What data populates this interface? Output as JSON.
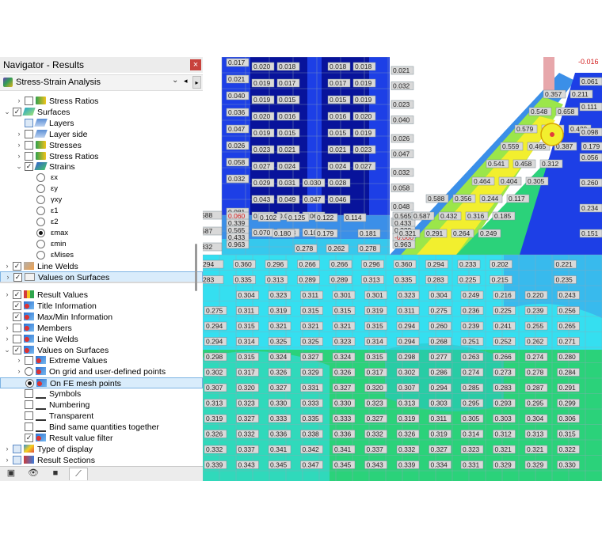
{
  "navigator": {
    "title": "Navigator - Results",
    "close_glyph": "×",
    "analysis": "Stress-Strain Analysis",
    "tree_top": [
      {
        "label": "Stress Ratios",
        "level": 1,
        "expander": "›",
        "check": "unchecked",
        "icon": "stress"
      },
      {
        "label": "Surfaces",
        "level": 0,
        "expander": "⌄",
        "check": "checked",
        "icon": "surface"
      },
      {
        "label": "Layers",
        "level": 1,
        "expander": "",
        "check": "partial",
        "icon": "layer"
      },
      {
        "label": "Layer side",
        "level": 1,
        "expander": "›",
        "check": "unchecked",
        "icon": "layer"
      },
      {
        "label": "Stresses",
        "level": 1,
        "expander": "›",
        "check": "unchecked",
        "icon": "stress"
      },
      {
        "label": "Stress Ratios",
        "level": 1,
        "expander": "›",
        "check": "unchecked",
        "icon": "stress"
      },
      {
        "label": "Strains",
        "level": 1,
        "expander": "⌄",
        "check": "checked",
        "icon": "strain"
      },
      {
        "label": "εx",
        "level": 2,
        "radio": false
      },
      {
        "label": "εy",
        "level": 2,
        "radio": false
      },
      {
        "label": "γxy",
        "level": 2,
        "radio": false
      },
      {
        "label": "ε1",
        "level": 2,
        "radio": false
      },
      {
        "label": "ε2",
        "level": 2,
        "radio": false
      },
      {
        "label": "εmax",
        "level": 2,
        "radio": true
      },
      {
        "label": "εmin",
        "level": 2,
        "radio": false
      },
      {
        "label": "εMises",
        "level": 2,
        "radio": false
      },
      {
        "label": "Line Welds",
        "level": 0,
        "expander": "›",
        "check": "checked",
        "icon": "weld"
      },
      {
        "label": "Values on Surfaces",
        "level": 0,
        "expander": "›",
        "check": "checked",
        "icon": "vals",
        "selected": true
      }
    ],
    "tree_bottom": [
      {
        "label": "Result Values",
        "level": 0,
        "expander": "›",
        "check": "checked",
        "icon": "res"
      },
      {
        "label": "Title Information",
        "level": 0,
        "expander": "",
        "check": "checked",
        "icon": "red"
      },
      {
        "label": "Max/Min Information",
        "level": 0,
        "expander": "",
        "check": "checked",
        "icon": "red"
      },
      {
        "label": "Members",
        "level": 0,
        "expander": "›",
        "check": "unchecked",
        "icon": "red"
      },
      {
        "label": "Line Welds",
        "level": 0,
        "expander": "›",
        "check": "unchecked",
        "icon": "red"
      },
      {
        "label": "Values on Surfaces",
        "level": 0,
        "expander": "⌄",
        "check": "checked",
        "icon": "red"
      },
      {
        "label": "Extreme Values",
        "level": 1,
        "expander": "›",
        "check": "unchecked",
        "icon": "red"
      },
      {
        "label": "On grid and user-defined points",
        "level": 1,
        "expander": "›",
        "radio": false,
        "icon": "red"
      },
      {
        "label": "On FE mesh points",
        "level": 1,
        "expander": "",
        "radio": true,
        "icon": "red",
        "selected": true
      },
      {
        "label": "Symbols",
        "level": 1,
        "expander": "",
        "check": "unchecked",
        "icon": "sym"
      },
      {
        "label": "Numbering",
        "level": 1,
        "expander": "",
        "check": "unchecked",
        "icon": "sym"
      },
      {
        "label": "Transparent",
        "level": 1,
        "expander": "",
        "check": "unchecked",
        "icon": "sym"
      },
      {
        "label": "Bind same quantities together",
        "level": 1,
        "expander": "",
        "check": "unchecked",
        "icon": "sym"
      },
      {
        "label": "Result value filter",
        "level": 1,
        "expander": "",
        "check": "checked",
        "icon": "red"
      },
      {
        "label": "Type of display",
        "level": 0,
        "expander": "›",
        "check": "partial",
        "icon": "disp"
      },
      {
        "label": "Result Sections",
        "level": 0,
        "expander": "›",
        "check": "partial",
        "icon": "sect"
      }
    ],
    "tabs": [
      {
        "name": "data-tab",
        "glyph": "▣"
      },
      {
        "name": "display-tab",
        "glyph": "👁"
      },
      {
        "name": "views-tab",
        "glyph": "■"
      },
      {
        "name": "results-tab",
        "glyph": "⟋",
        "active": true
      }
    ]
  },
  "viewport": {
    "colors": {
      "navy": "#08139b",
      "blue": "#1d3fe6",
      "mid_blue": "#3b8fe8",
      "cyan": "#35dff0",
      "teal": "#26c6c8",
      "green": "#2bd27a",
      "lime": "#9be64a",
      "yellow": "#f2ef2e",
      "pink": "#e7a7ab",
      "grid": "#8fa7b8",
      "label_bg": "#d9d9d9"
    },
    "left_block_labels": [
      [
        "0.017",
        "0.020",
        "0.018",
        "",
        "0.018",
        "0.018"
      ],
      [
        "0.021",
        "0.019",
        "0.017",
        "",
        "0.017",
        "0.019"
      ],
      [
        "0.040",
        "0.019",
        "0.015",
        "",
        "0.015",
        "0.019"
      ],
      [
        "0.036",
        "0.020",
        "0.016",
        "",
        "0.016",
        "0.020"
      ],
      [
        "0.047",
        "0.019",
        "0.015",
        "",
        "0.015",
        "0.019"
      ],
      [
        "0.026",
        "0.023",
        "0.021",
        "",
        "0.021",
        "0.023"
      ],
      [
        "0.058",
        "0.027",
        "0.024",
        "",
        "0.024",
        "0.027"
      ],
      [
        "0.032",
        "0.029",
        "0.031",
        "0.030",
        "0.028",
        ""
      ],
      [
        "",
        "0.043",
        "0.049",
        "0.047",
        "0.046",
        ""
      ],
      [
        "0.081",
        "0.075",
        "0.078",
        "0.069",
        ""
      ],
      [
        "0.048",
        "0.070",
        "0.103",
        "0.105",
        ""
      ]
    ],
    "right_column_labels": [
      "0.021",
      "0.032",
      "0.023",
      "0.040",
      "0.026",
      "0.047",
      "0.032",
      "0.058",
      "0.048",
      "0.081"
    ],
    "strip_labels": [
      "0.565",
      "0.433",
      "0.339",
      "-0.060",
      "0.963"
    ],
    "left_mini": [
      "0.060",
      "0.339",
      "0.565",
      "0.433",
      "0.963"
    ],
    "left_mini_red": "0.060",
    "red_negative": "-0.060",
    "top_row_a": [
      "0.278",
      "0.262",
      "0.278"
    ],
    "top_row_b": [
      "0.102",
      "0.125",
      "0.122",
      "0.114"
    ],
    "top_row_c": [
      "0.180",
      "0.179",
      "0.181"
    ],
    "left_edge": [
      "588",
      "587",
      "332"
    ],
    "diag_labels": [
      [
        "0.357",
        "0.211"
      ],
      [
        "0.548",
        "0.658"
      ],
      [
        "0.579",
        "0.479",
        "0.439"
      ],
      [
        "0.559",
        "0.465",
        "0.387",
        "0.179"
      ],
      [
        "0.541",
        "0.458",
        "0.312"
      ],
      [
        "0.464",
        "0.404",
        "0.305"
      ],
      [
        "0.588",
        "0.356",
        "0.244",
        "0.117"
      ],
      [
        "0.587",
        "0.432",
        "0.316",
        "0.185"
      ],
      [
        "0.321",
        "0.291",
        "0.264",
        "0.249"
      ]
    ],
    "diag_far": [
      "0.061",
      "0.111",
      "0.098",
      "0.056",
      "0.260",
      "0.234",
      "0.151"
    ],
    "corner_value": "-0.016",
    "mesh_rows": [
      [
        "294",
        "0.360",
        "0.296",
        "0.266",
        "0.266",
        "0.296",
        "0.360",
        "0.294",
        "0.233",
        "0.202",
        "",
        "0.221",
        "0.240",
        "0.246"
      ],
      [
        "283",
        "0.335",
        "0.313",
        "0.289",
        "0.289",
        "0.313",
        "0.335",
        "0.283",
        "0.225",
        "0.215",
        "",
        "0.235",
        "0.245",
        "0.239"
      ],
      [
        "",
        "0.304",
        "0.323",
        "0.311",
        "0.301",
        "0.301",
        "0.323",
        "0.304",
        "0.249",
        "0.216",
        "0.220",
        "0.243",
        "0.255"
      ],
      [
        "0.275",
        "0.311",
        "0.319",
        "0.315",
        "0.315",
        "0.319",
        "0.311",
        "0.275",
        "0.236",
        "0.225",
        "0.239",
        "0.256",
        "0.261"
      ],
      [
        "0.294",
        "0.315",
        "0.321",
        "0.321",
        "0.321",
        "0.315",
        "0.294",
        "0.260",
        "0.239",
        "0.241",
        "0.255",
        "0.265"
      ],
      [
        "0.294",
        "0.314",
        "0.325",
        "0.325",
        "0.323",
        "0.314",
        "0.294",
        "0.268",
        "0.251",
        "0.252",
        "0.262",
        "0.271"
      ],
      [
        "0.298",
        "0.315",
        "0.324",
        "0.327",
        "0.324",
        "0.315",
        "0.298",
        "0.277",
        "0.263",
        "0.266",
        "0.274",
        "0.280"
      ],
      [
        "0.302",
        "0.317",
        "0.326",
        "0.329",
        "0.326",
        "0.317",
        "0.302",
        "0.286",
        "0.274",
        "0.273",
        "0.278",
        "0.284"
      ],
      [
        "0.307",
        "0.320",
        "0.327",
        "0.331",
        "0.327",
        "0.320",
        "0.307",
        "0.294",
        "0.285",
        "0.283",
        "0.287",
        "0.291"
      ],
      [
        "0.313",
        "0.323",
        "0.330",
        "0.333",
        "0.330",
        "0.323",
        "0.313",
        "0.303",
        "0.295",
        "0.293",
        "0.295",
        "0.299"
      ],
      [
        "0.319",
        "0.327",
        "0.333",
        "0.335",
        "0.333",
        "0.327",
        "0.319",
        "0.311",
        "0.305",
        "0.303",
        "0.304",
        "0.306"
      ],
      [
        "0.326",
        "0.332",
        "0.336",
        "0.338",
        "0.336",
        "0.332",
        "0.326",
        "0.319",
        "0.314",
        "0.312",
        "0.313",
        "0.315"
      ],
      [
        "0.332",
        "0.337",
        "0.341",
        "0.342",
        "0.341",
        "0.337",
        "0.332",
        "0.327",
        "0.323",
        "0.321",
        "0.321",
        "0.322"
      ],
      [
        "0.339",
        "0.343",
        "0.345",
        "0.347",
        "0.345",
        "0.343",
        "0.339",
        "0.334",
        "0.331",
        "0.329",
        "0.329",
        "0.330"
      ]
    ]
  }
}
